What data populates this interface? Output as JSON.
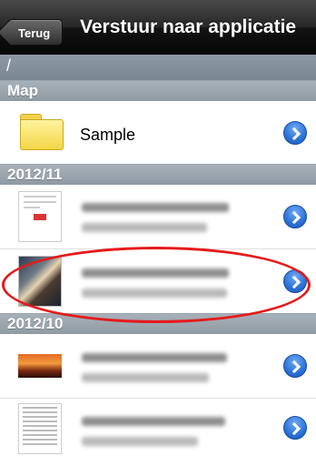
{
  "navbar": {
    "back_label": "Terug",
    "title": "Verstuur naar applicatie"
  },
  "path": "/",
  "sections": [
    {
      "title": "Map"
    },
    {
      "title": "2012/11"
    },
    {
      "title": "2012/10"
    }
  ],
  "folder_row": {
    "label": "Sample",
    "icon": "folder-icon"
  },
  "files": [
    {
      "section": "2012/11",
      "thumbnail": "document-thumbnail"
    },
    {
      "section": "2012/11",
      "thumbnail": "tiger-photo-thumbnail",
      "highlighted": true
    },
    {
      "section": "2012/10",
      "thumbnail": "sunset-photo-thumbnail"
    },
    {
      "section": "2012/10",
      "thumbnail": "article-thumbnail"
    }
  ],
  "colors": {
    "accent": "#2c72d8",
    "highlight": "#e41b1b",
    "section": "#9aa4ad"
  }
}
